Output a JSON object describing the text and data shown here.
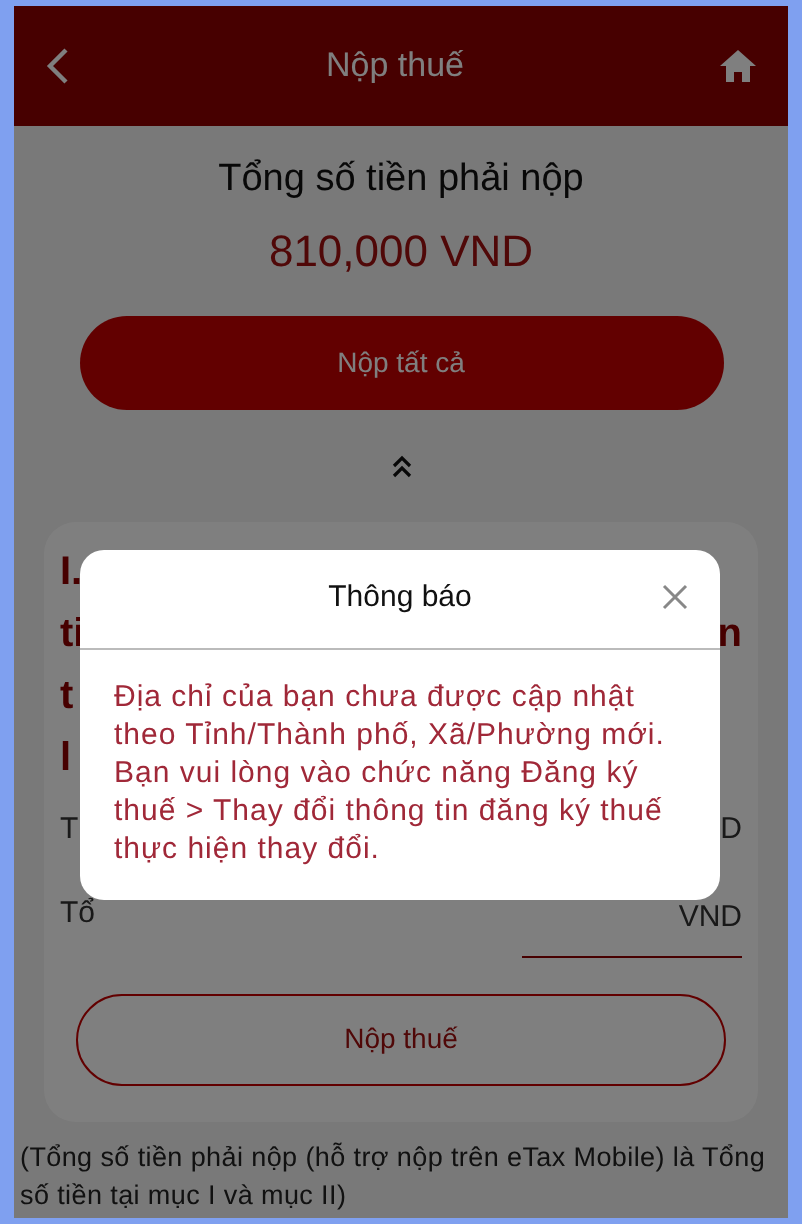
{
  "header": {
    "title": "Nộp thuế"
  },
  "summary": {
    "label": "Tổng số tiền phải nộp",
    "amount": "810,000 VND",
    "button": "Nộp tất cả"
  },
  "section": {
    "title_lines": [
      {
        "left": "I."
      },
      {
        "left": "ti",
        "right": "n"
      },
      {
        "left": "t"
      },
      {
        "left": "l"
      }
    ],
    "rows": [
      {
        "label": "T",
        "value": "D"
      },
      {
        "label": "Tổ",
        "value": "VND"
      }
    ],
    "button": "Nộp thuế"
  },
  "footnote": "(Tổng số tiền phải nộp (hỗ trợ nộp trên eTax Mobile) là Tổng số tiền tại mục I và mục II)",
  "dialog": {
    "title": "Thông báo",
    "message": "Địa chỉ của bạn chưa được cập nhật theo Tỉnh/Thành phố, Xã/Phường mới. Bạn vui lòng vào chức năng Đăng ký thuế > Thay đổi thông tin đăng ký thuế thực hiện thay đổi."
  }
}
